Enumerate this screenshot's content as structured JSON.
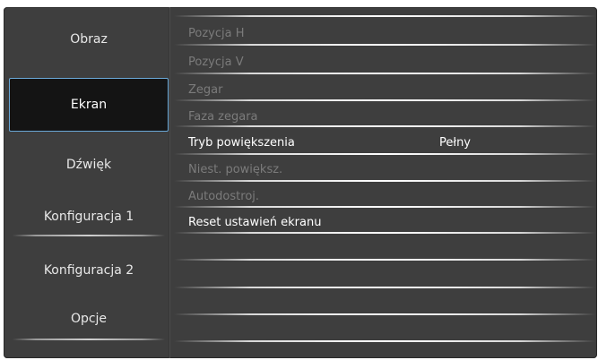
{
  "menu": {
    "categories": [
      {
        "label": "Obraz",
        "selected": false
      },
      {
        "label": "Ekran",
        "selected": true
      },
      {
        "label": "Dźwięk",
        "selected": false
      },
      {
        "label": "Konfiguracja 1",
        "selected": false
      },
      {
        "label": "Konfiguracja 2",
        "selected": false
      },
      {
        "label": "Opcje",
        "selected": false
      }
    ],
    "options": [
      {
        "label": "Pozycja H",
        "value": "",
        "enabled": false
      },
      {
        "label": "Pozycja V",
        "value": "",
        "enabled": false
      },
      {
        "label": "Zegar",
        "value": "",
        "enabled": false
      },
      {
        "label": "Faza zegara",
        "value": "",
        "enabled": false
      },
      {
        "label": "Tryb powiększenia",
        "value": "Pełny",
        "enabled": true
      },
      {
        "label": "Niest. powiększ.",
        "value": "",
        "enabled": false
      },
      {
        "label": "Autodostroj.",
        "value": "",
        "enabled": false
      },
      {
        "label": "Reset ustawień ekranu",
        "value": "",
        "enabled": true
      }
    ]
  },
  "colors": {
    "panel": "#3e3e3e",
    "selected_bg": "#141414",
    "selected_border": "#6aa9d8",
    "text_active": "#ffffff",
    "text_disabled": "#7b7b7b"
  }
}
